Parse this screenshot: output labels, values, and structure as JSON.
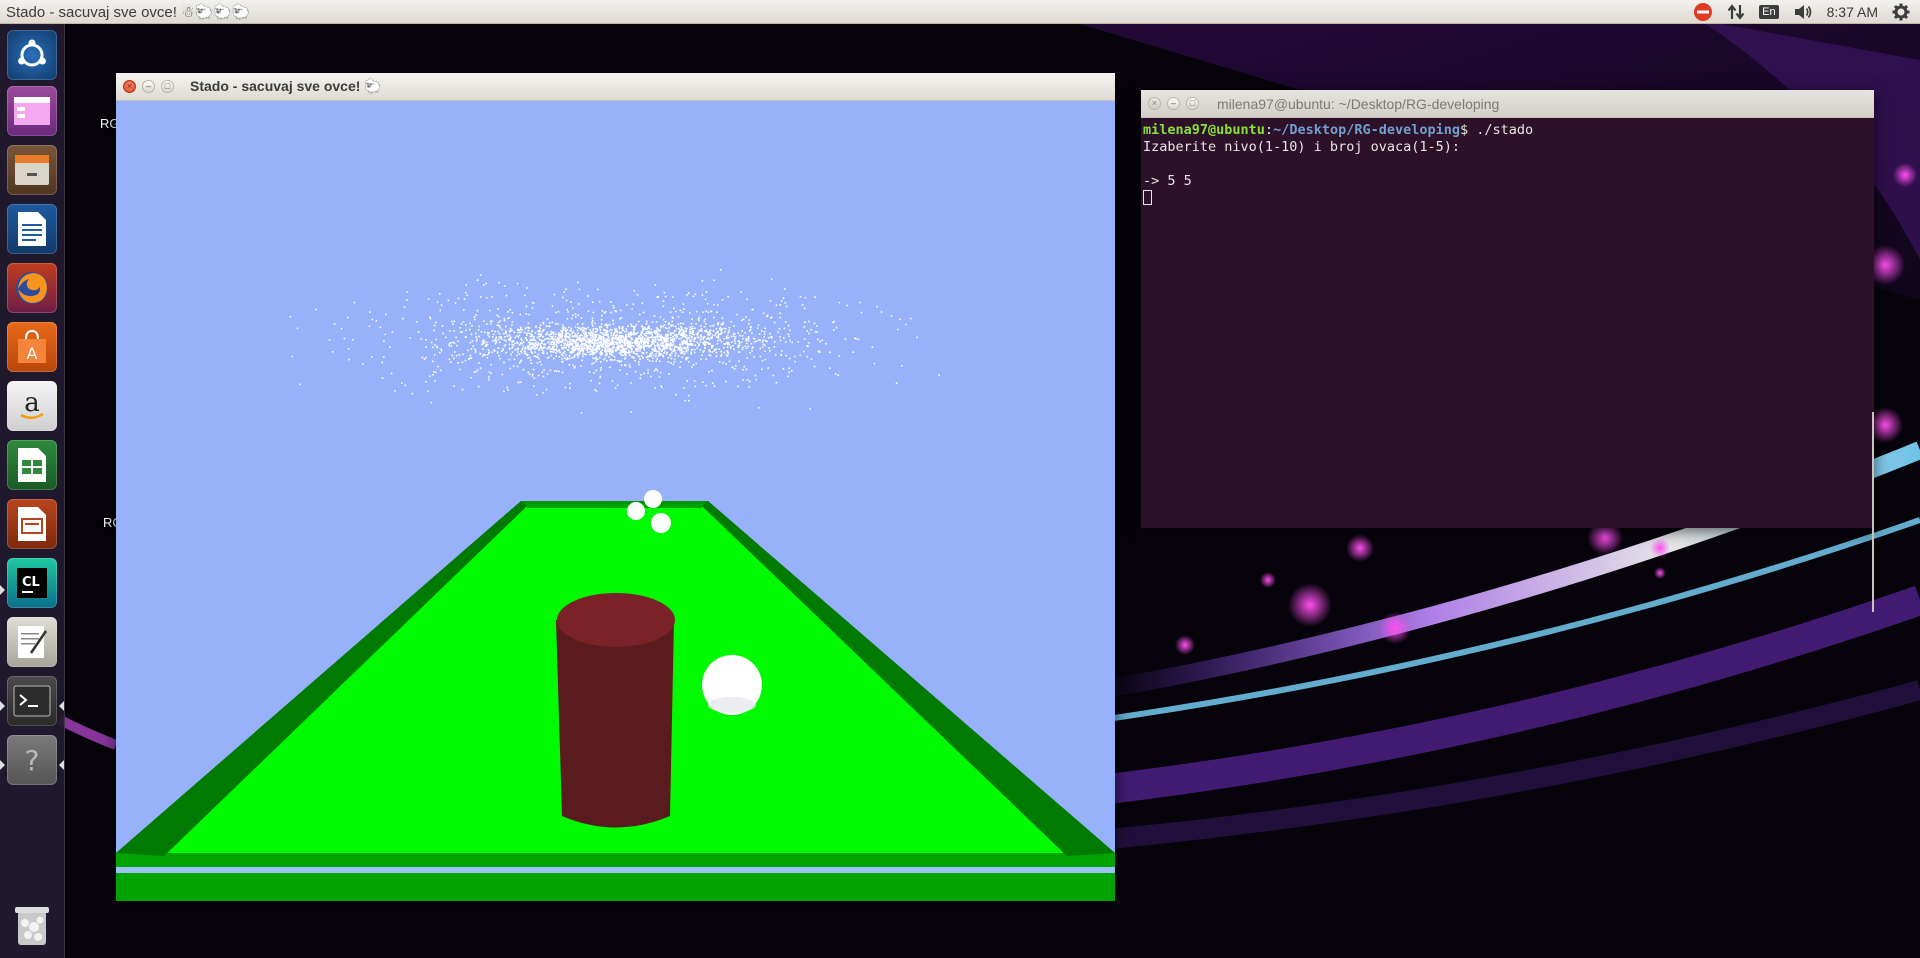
{
  "top_panel": {
    "app_title": "Stado - sacuvaj sve ovce! ☃🐑🐑🐑",
    "indicators": [
      "no-entry-icon",
      "network-arrows-icon",
      "keyboard-language-icon",
      "volume-icon",
      "system-gear-icon"
    ],
    "language": "En",
    "clock": "8:37 AM"
  },
  "launcher": {
    "items": [
      {
        "name": "ubuntu-dash",
        "icon": "ubuntu-logo-icon"
      },
      {
        "name": "workspace-switcher",
        "icon": "workspaces-icon"
      },
      {
        "name": "files",
        "icon": "file-cabinet-icon"
      },
      {
        "name": "libreoffice-writer",
        "icon": "writer-document-icon"
      },
      {
        "name": "firefox",
        "icon": "firefox-icon"
      },
      {
        "name": "ubuntu-software",
        "icon": "shopping-bag-icon"
      },
      {
        "name": "amazon",
        "icon": "amazon-icon"
      },
      {
        "name": "libreoffice-calc",
        "icon": "spreadsheet-icon"
      },
      {
        "name": "libreoffice-impress",
        "icon": "presentation-icon"
      },
      {
        "name": "clion",
        "icon": "clion-icon"
      },
      {
        "name": "text-editor",
        "icon": "notepad-icon"
      },
      {
        "name": "terminal",
        "icon": "terminal-icon"
      },
      {
        "name": "unknown-app",
        "icon": "question-mark-icon"
      },
      {
        "name": "trash",
        "icon": "trash-icon"
      }
    ]
  },
  "desktop": {
    "label_fragment_1": "RG",
    "label_fragment_2": "RG"
  },
  "game_window": {
    "title": "Stado - sacuvaj sve ovce! 🐑",
    "colors": {
      "sky": "#97b1fb",
      "field": "#00fb00",
      "field_border": "#009600",
      "field_front": "#006d00",
      "cylinder_side": "#5a1b1e",
      "cylinder_top": "#7a2227",
      "sheep": "#ffffff"
    }
  },
  "terminal_window": {
    "title": "milena97@ubuntu: ~/Desktop/RG-developing",
    "prompt_user": "milena97@ubuntu",
    "prompt_sep": ":",
    "prompt_path": "~/Desktop/RG-developing",
    "prompt_end": "$ ",
    "command": "./stado",
    "output_line_1": "Izaberite nivo(1-10) i broj ovaca(1-5):",
    "output_line_2": "",
    "input_line": "-> 5 5"
  }
}
